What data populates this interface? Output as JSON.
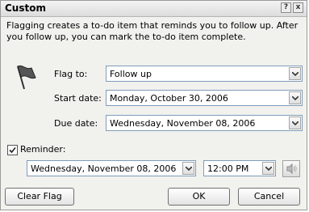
{
  "dialog": {
    "title": "Custom",
    "help_label": "?",
    "close_label": "x"
  },
  "info_text": "Flagging creates a to-do item that reminds you to follow up. After you follow up, you can mark the to-do item complete.",
  "fields": {
    "flag_to": {
      "label": "Flag to:",
      "value": "Follow up"
    },
    "start_date": {
      "label": "Start date:",
      "value": "Monday, October 30, 2006"
    },
    "due_date": {
      "label": "Due date:",
      "value": "Wednesday, November 08, 2006"
    }
  },
  "reminder": {
    "label": "Reminder:",
    "checked": true,
    "date": "Wednesday, November 08, 2006",
    "time": "12:00 PM"
  },
  "buttons": {
    "clear_flag": "Clear Flag",
    "ok": "OK",
    "cancel": "Cancel"
  },
  "icons": [
    "flag-icon",
    "checkmark-icon",
    "dropdown-arrow-icon",
    "speaker-icon",
    "help-icon",
    "close-icon"
  ]
}
